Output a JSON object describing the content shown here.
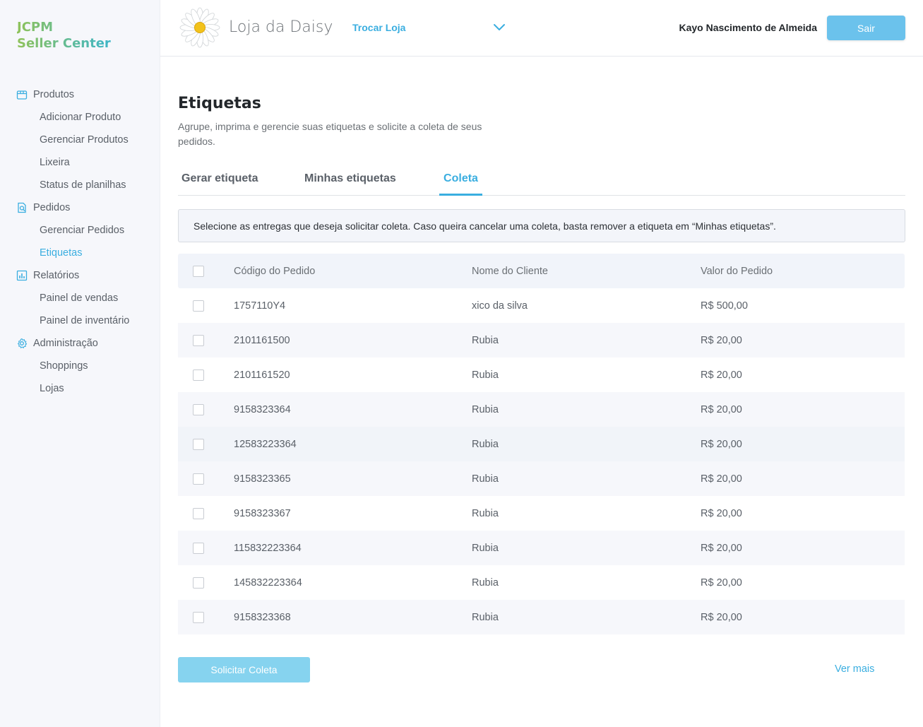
{
  "brand": {
    "line1": "JCPM",
    "line2": "Seller Center"
  },
  "sidebar": {
    "sections": [
      {
        "label": "Produtos",
        "icon": "box-icon",
        "items": [
          "Adicionar Produto",
          "Gerenciar Produtos",
          "Lixeira",
          "Status de planilhas"
        ]
      },
      {
        "label": "Pedidos",
        "icon": "search-document-icon",
        "items": [
          "Gerenciar Pedidos",
          "Etiquetas"
        ]
      },
      {
        "label": "Relatórios",
        "icon": "bar-chart-icon",
        "items": [
          "Painel de vendas",
          "Painel de inventário"
        ]
      },
      {
        "label": "Administração",
        "icon": "gear-icon",
        "items": [
          "Shoppings",
          "Lojas"
        ]
      }
    ],
    "active_item": "Etiquetas"
  },
  "header": {
    "store_name": "Loja da Daisy",
    "switch_store": "Trocar Loja",
    "user_name": "Kayo Nascimento de Almeida",
    "logout": "Sair"
  },
  "page": {
    "title": "Etiquetas",
    "description": "Agrupe, imprima e gerencie suas etiquetas e solicite a coleta de seus pedidos.",
    "tabs": [
      "Gerar etiqueta",
      "Minhas etiquetas",
      "Coleta"
    ],
    "active_tab": "Coleta",
    "info": "Selecione as entregas que deseja solicitar coleta. Caso queira cancelar uma coleta, basta remover a etiqueta em “Minhas etiquetas”."
  },
  "table": {
    "headers": [
      "Código do Pedido",
      "Nome do Cliente",
      "Valor do Pedido"
    ],
    "rows": [
      [
        "1757110Y4",
        "xico da silva",
        "R$ 500,00"
      ],
      [
        "2101161500",
        "Rubia",
        "R$ 20,00"
      ],
      [
        "2101161520",
        "Rubia",
        "R$ 20,00"
      ],
      [
        "9158323364",
        "Rubia",
        "R$ 20,00"
      ],
      [
        "12583223364",
        "Rubia",
        "R$ 20,00"
      ],
      [
        "9158323365",
        "Rubia",
        "R$ 20,00"
      ],
      [
        "9158323367",
        "Rubia",
        "R$ 20,00"
      ],
      [
        "115832223364",
        "Rubia",
        "R$ 20,00"
      ],
      [
        "145832223364",
        "Rubia",
        "R$ 20,00"
      ],
      [
        "9158323368",
        "Rubia",
        "R$ 20,00"
      ]
    ]
  },
  "actions": {
    "request_collect": "Solicitar Coleta",
    "see_more": "Ver mais"
  },
  "colors": {
    "accent": "#3aaee0",
    "button": "#6bc2ec",
    "button_disabled": "#86d3ef",
    "brand_green": "#8fc25a",
    "brand_teal": "#3db6c8"
  }
}
